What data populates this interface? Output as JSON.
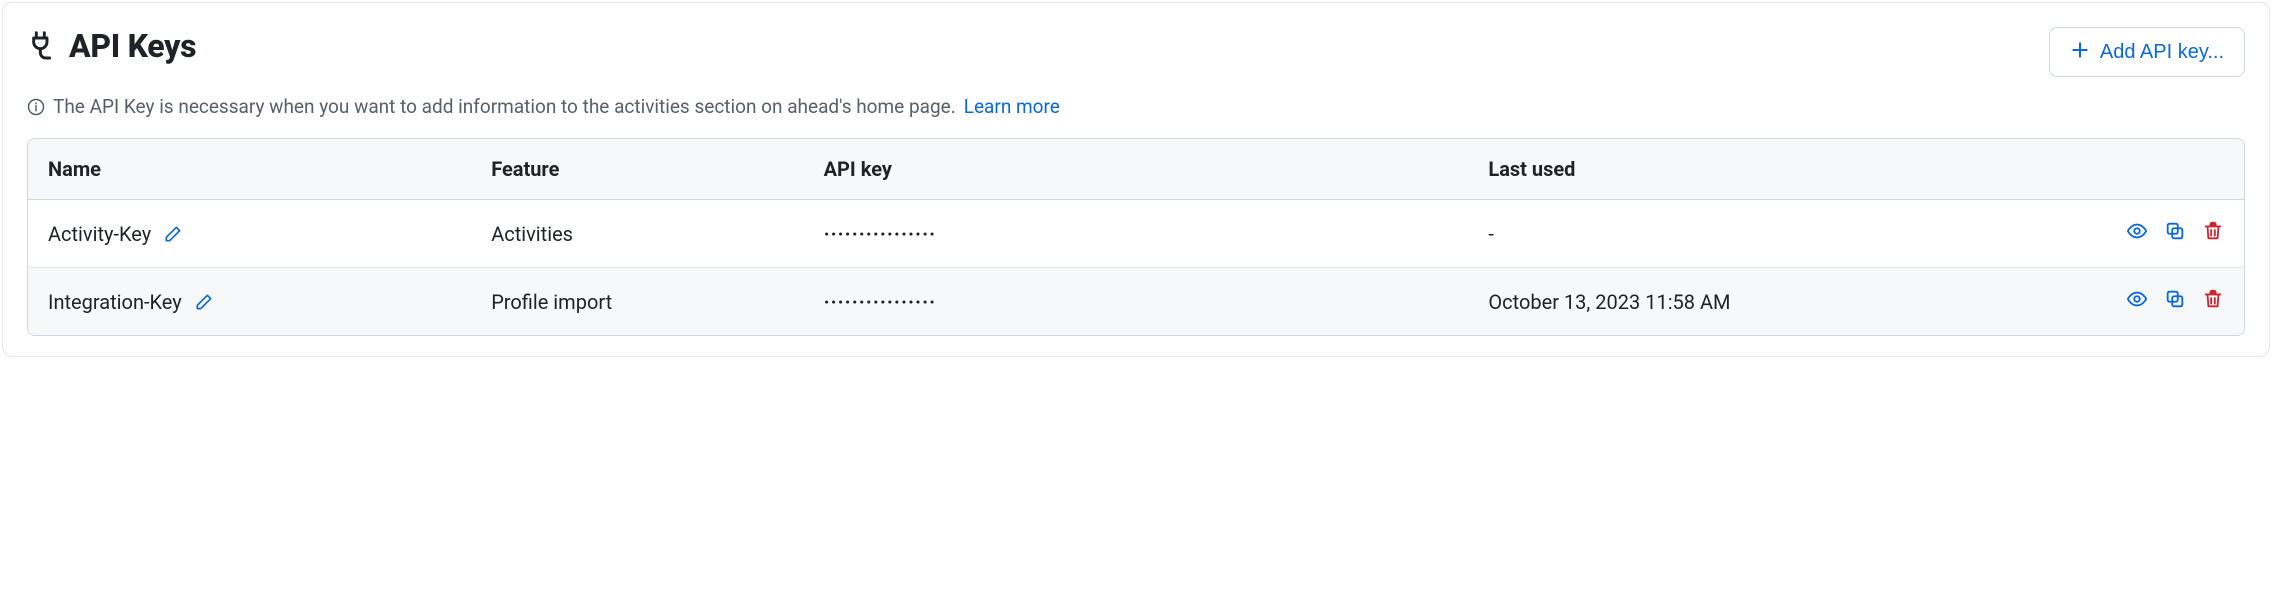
{
  "header": {
    "title": "API Keys",
    "add_button_label": "Add API key..."
  },
  "info": {
    "text": "The API Key is necessary when you want to add information to the activities section on ahead's home page.",
    "learn_more_label": "Learn more"
  },
  "table": {
    "columns": {
      "name": "Name",
      "feature": "Feature",
      "api_key": "API key",
      "last_used": "Last used"
    },
    "rows": [
      {
        "name": "Activity-Key",
        "feature": "Activities",
        "key_masked": "················",
        "last_used": "-"
      },
      {
        "name": "Integration-Key",
        "feature": "Profile import",
        "key_masked": "················",
        "last_used": "October 13, 2023 11:58 AM"
      }
    ]
  }
}
